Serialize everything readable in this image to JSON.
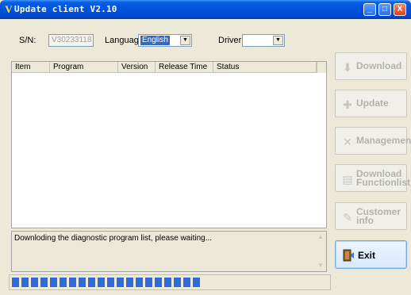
{
  "window": {
    "title": "Update client V2.10",
    "icon": "v-logo-icon",
    "controls": {
      "minimize": "_",
      "maximize": "□",
      "close": "X"
    }
  },
  "toolbar": {
    "sn_label": "S/N:",
    "sn_value": "V30233118",
    "language_label": "Language",
    "language_value": "English",
    "driver_label": "Driver:",
    "driver_value": ""
  },
  "list": {
    "columns": [
      "Item",
      "Program",
      "Version",
      "Release Time",
      "Status"
    ],
    "rows": []
  },
  "log": {
    "message": "Downloding the diagnostic program list, please waiting..."
  },
  "progress": {
    "fraction": 0.6
  },
  "actions": [
    {
      "label": "Download",
      "icon": "download-icon",
      "enabled": false
    },
    {
      "label": "Update",
      "icon": "update-icon",
      "enabled": false
    },
    {
      "label": "Management",
      "icon": "wrench-icon",
      "enabled": false
    },
    {
      "label": "Download\nFunctionlist",
      "icon": "document-icon",
      "enabled": false
    },
    {
      "label": "Customer\ninfo",
      "icon": "edit-icon",
      "enabled": false
    }
  ],
  "exit": {
    "label": "Exit",
    "icon": "exit-door-icon"
  },
  "colors": {
    "titlebar": "#0050dc",
    "progress": "#2d6cd8",
    "accent": "#316ac5"
  }
}
